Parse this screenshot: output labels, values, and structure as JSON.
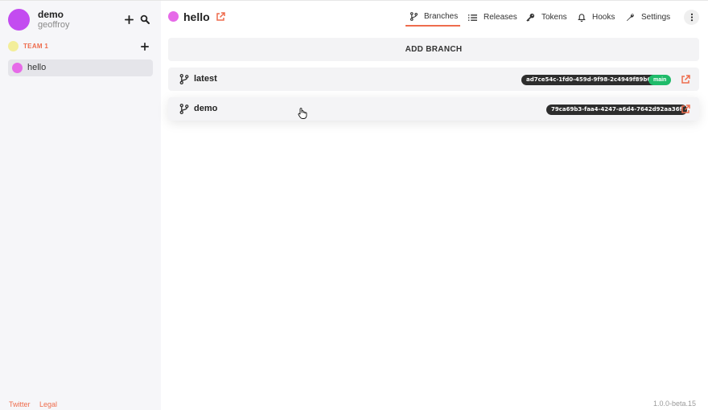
{
  "user": {
    "name": "demo",
    "login": "geoffroy"
  },
  "team": {
    "label": "TEAM 1"
  },
  "sidebar": {
    "projects": [
      {
        "label": "hello"
      }
    ]
  },
  "footer": {
    "links": [
      "Twitter",
      "Legal"
    ],
    "version": "1.0.0-beta.15"
  },
  "project": {
    "title": "hello"
  },
  "tabs": [
    {
      "label": "Branches",
      "icon": "branch-icon",
      "active": true
    },
    {
      "label": "Releases",
      "icon": "list-icon",
      "active": false
    },
    {
      "label": "Tokens",
      "icon": "key-icon",
      "active": false
    },
    {
      "label": "Hooks",
      "icon": "bell-icon",
      "active": false
    },
    {
      "label": "Settings",
      "icon": "wrench-icon",
      "active": false
    }
  ],
  "add_branch_label": "ADD BRANCH",
  "branches": [
    {
      "name": "latest",
      "hash": "ad7ce54c-1fd0-459d-9f98-2c4949f89b61",
      "badge": "main"
    },
    {
      "name": "demo",
      "hash": "79ca69b3-faa4-4247-a6d4-7642d92aa36f"
    }
  ],
  "colors": {
    "accent": "#ee6c4d",
    "user_avatar": "#c34cf0",
    "project_dot": "#e66ae8",
    "team_dot": "#f3ee9a",
    "main_badge": "#1fbb6a",
    "hash_badge": "#2d2d2d"
  }
}
